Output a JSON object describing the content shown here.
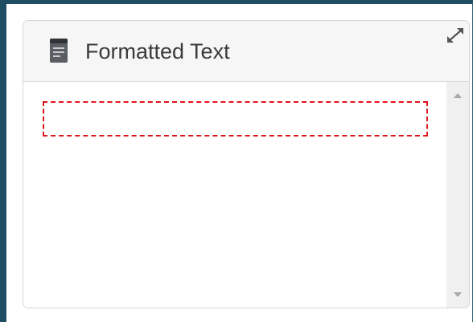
{
  "widget": {
    "title": "Formatted Text",
    "icon": "document-icon",
    "resize_left_icon": "resize-diagonal-icon",
    "resize_right_icon": "expand-diagonal-icon",
    "placeholder_color": "#e0141a"
  },
  "colors": {
    "frame": "#1f4e63",
    "header_bg": "#f6f6f6",
    "title_text": "#3a3a3a",
    "scrollbar_bg": "#f0f0f0"
  }
}
